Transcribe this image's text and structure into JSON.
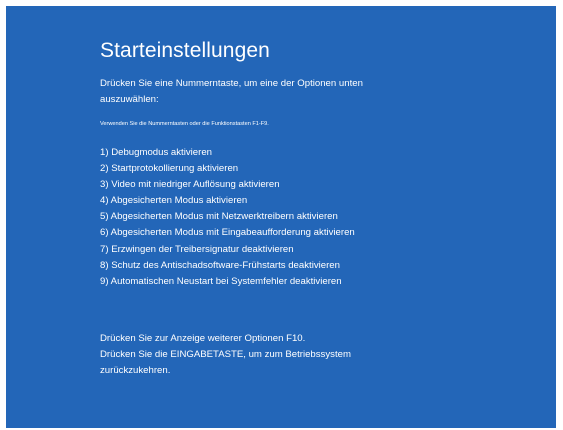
{
  "screen": {
    "background_color": "#2366b8",
    "text_color": "#ffffff",
    "title": "Starteinstellungen",
    "instruction": "Drücken Sie eine Nummerntaste, um eine der Optionen unten auszuwählen:",
    "hint": "Verwenden Sie die Nummerntasten oder die Funktionstasten F1-F9.",
    "options": [
      "1) Debugmodus aktivieren",
      "2) Startprotokollierung aktivieren",
      "3) Video mit niedriger Auflösung aktivieren",
      "4) Abgesicherten Modus aktivieren",
      "5) Abgesicherten Modus mit Netzwerktreibern aktivieren",
      "6) Abgesicherten Modus mit Eingabeaufforderung aktivieren",
      "7) Erzwingen der Treibersignatur deaktivieren",
      "8) Schutz des Antischadsoftware-Frühstarts deaktivieren",
      "9) Automatischen Neustart bei Systemfehler deaktivieren"
    ],
    "footer_more_options": "Drücken Sie zur Anzeige weiterer Optionen F10.",
    "footer_return": "Drücken Sie die EINGABETASTE, um zum Betriebssystem zurückzukehren."
  }
}
